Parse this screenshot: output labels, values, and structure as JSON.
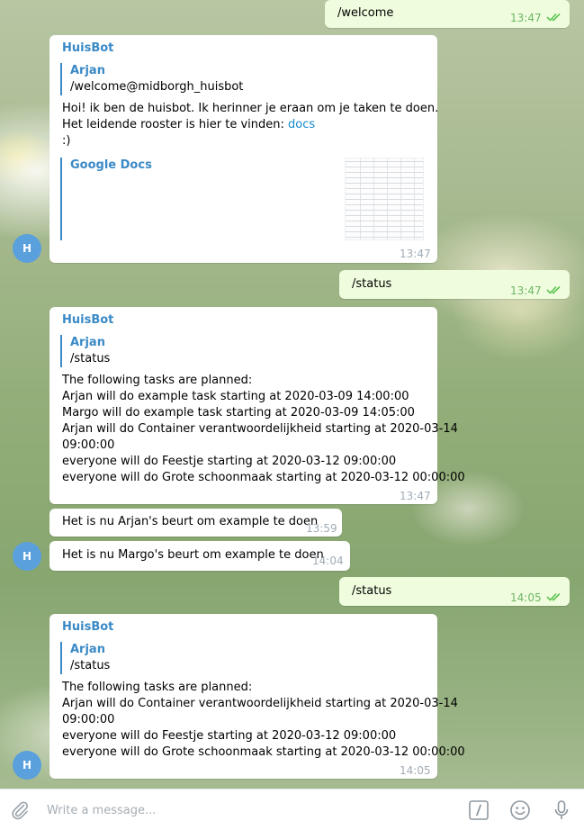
{
  "messages": {
    "m1": {
      "text": "/welcome",
      "time": "13:47"
    },
    "m2": {
      "sender": "HuisBot",
      "reply_name": "Arjan",
      "reply_text": "/welcome@midborgh_huisbot",
      "line1": "Hoi! ik ben de huisbot. Ik herinner je eraan om je taken te doen.",
      "line2_prefix": "Het leidende rooster is hier te vinden: ",
      "line2_link": "docs",
      "line3": ":)",
      "preview_title": "Google Docs",
      "time": "13:47"
    },
    "m3": {
      "text": "/status",
      "time": "13:47"
    },
    "m4": {
      "sender": "HuisBot",
      "reply_name": "Arjan",
      "reply_text": "/status",
      "lines": [
        "The following tasks are planned:",
        "Arjan will do example task starting at 2020-03-09 14:00:00",
        "Margo will do example task starting at 2020-03-09 14:05:00",
        "Arjan will do Container verantwoordelijkheid starting at 2020-03-14",
        "09:00:00",
        "everyone will do Feestje starting at 2020-03-12 09:00:00",
        "everyone will do Grote schoonmaak starting at 2020-03-12 00:00:00"
      ],
      "time": "13:47"
    },
    "m5": {
      "text": "Het is nu Arjan's beurt om example te doen",
      "time": "13:59"
    },
    "m6": {
      "text": "Het is nu Margo's beurt om example te doen",
      "time": "14:04"
    },
    "m7": {
      "text": "/status",
      "time": "14:05"
    },
    "m8": {
      "sender": "HuisBot",
      "reply_name": "Arjan",
      "reply_text": "/status",
      "lines": [
        "The following tasks are planned:",
        "Arjan will do Container verantwoordelijkheid starting at 2020-03-14",
        "09:00:00",
        "everyone will do Feestje starting at 2020-03-12 09:00:00",
        "everyone will do Grote schoonmaak starting at 2020-03-12 00:00:00"
      ],
      "time": "14:05"
    }
  },
  "avatar_initial": "H",
  "composer": {
    "placeholder": "Write a message..."
  },
  "colors": {
    "accent": "#3a8ac6",
    "link": "#168acd",
    "outgoing_bubble": "#effdde",
    "incoming_bubble": "#ffffff",
    "read_ticks": "#5dc452",
    "avatar": "#5aa0dd"
  },
  "icons": {
    "attach": "paperclip-icon",
    "commands": "slash-command-icon",
    "emoji": "smile-icon",
    "voice": "microphone-icon",
    "read": "double-check-icon"
  }
}
